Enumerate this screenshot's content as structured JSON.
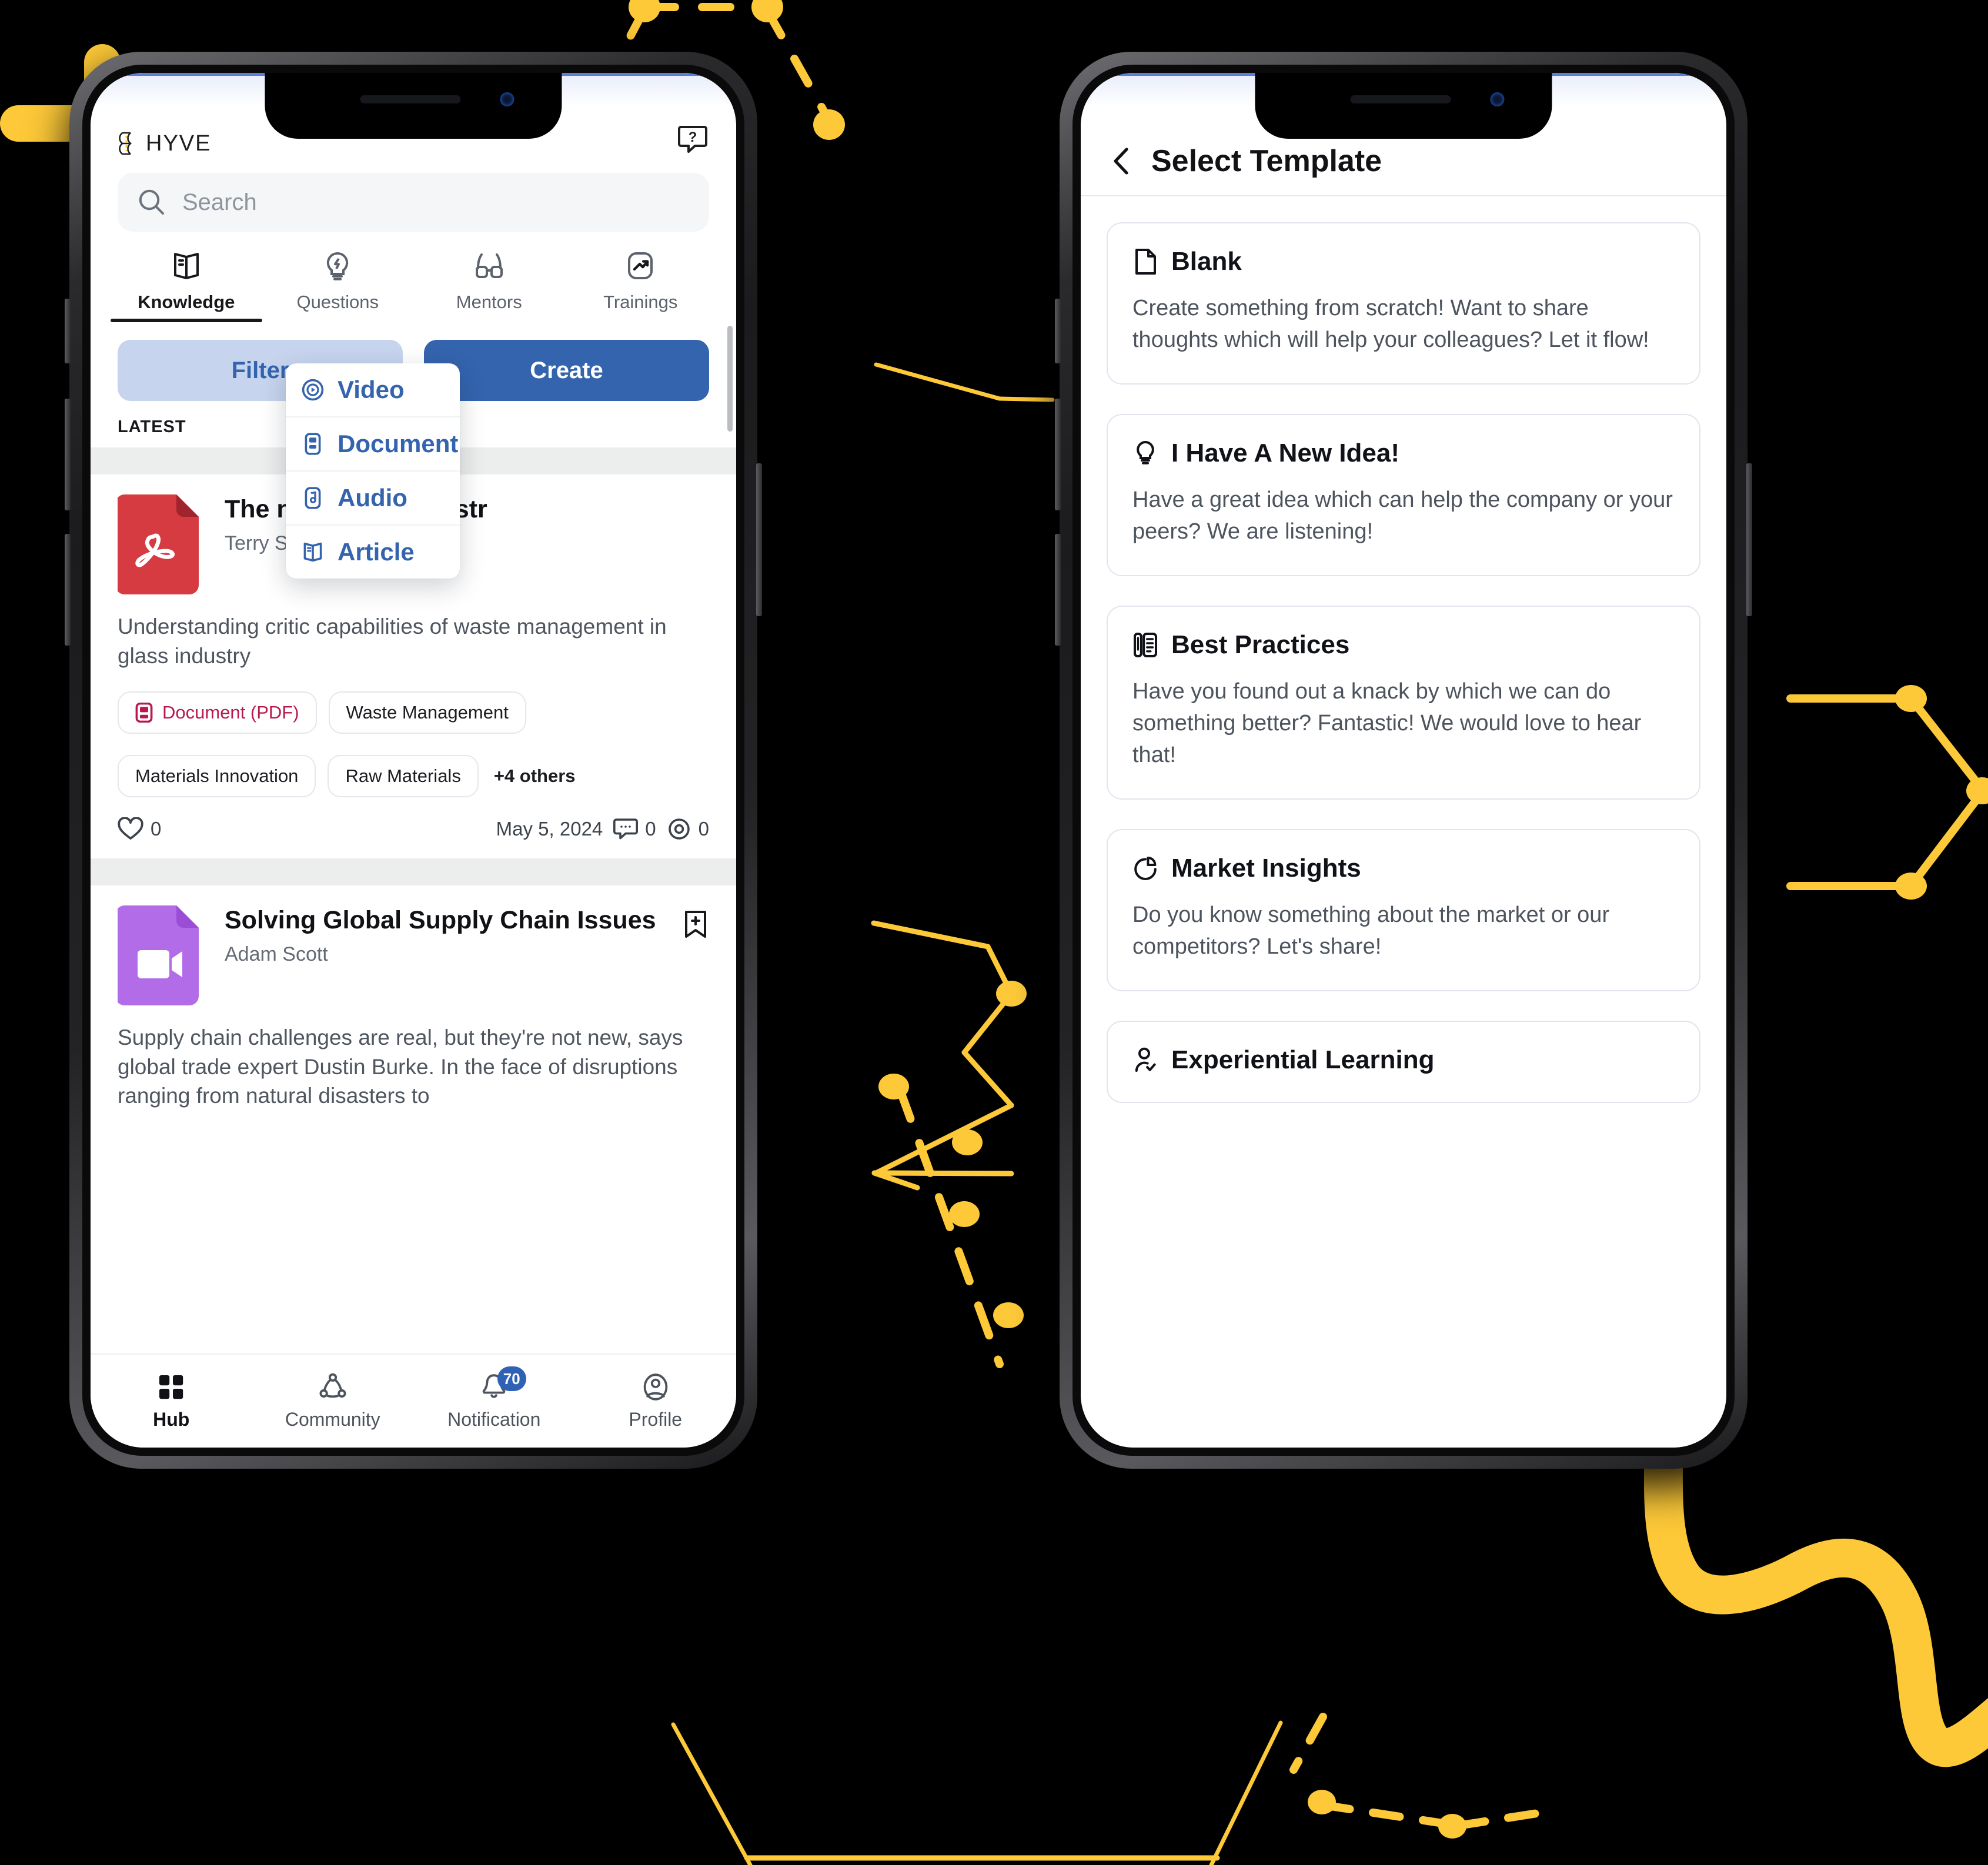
{
  "app": {
    "brand": "HYVE",
    "help_icon": "help-question-icon",
    "search": {
      "placeholder": "Search",
      "icon": "search-icon"
    },
    "tabs": [
      {
        "label": "Knowledge",
        "icon": "book-icon",
        "active": true
      },
      {
        "label": "Questions",
        "icon": "lightbulb-bolt-icon",
        "active": false
      },
      {
        "label": "Mentors",
        "icon": "glasses-icon",
        "active": false
      },
      {
        "label": "Trainings",
        "icon": "trending-up-icon",
        "active": false
      }
    ],
    "filter_label": "Filter",
    "create_label": "Create",
    "section_label": "LATEST",
    "create_menu": [
      {
        "label": "Video",
        "icon": "play-circle-icon"
      },
      {
        "label": "Document",
        "icon": "document-icon"
      },
      {
        "label": "Audio",
        "icon": "music-note-icon"
      },
      {
        "label": "Article",
        "icon": "open-book-icon"
      }
    ],
    "feed": [
      {
        "file_type": "pdf",
        "title": "The ne    manag   industr",
        "author": "Terry Sm",
        "description": "Understanding critic                  capabilities of waste management in glass industry",
        "tags": [
          "Document (PDF)",
          "Waste Management",
          "Materials Innovation",
          "Raw Materials"
        ],
        "tags_more": "+4 others",
        "likes": "0",
        "date": "May 5, 2024",
        "comments": "0",
        "views": "0"
      },
      {
        "file_type": "video",
        "title": "Solving Global Supply Chain Issues",
        "author": "Adam Scott",
        "description": "Supply chain challenges are real, but they're not new, says global trade expert Dustin Burke. In the face of disruptions ranging from natural disasters to"
      }
    ],
    "bottom_nav": [
      {
        "label": "Hub",
        "icon": "grid-icon",
        "active": true,
        "badge": ""
      },
      {
        "label": "Community",
        "icon": "community-icon",
        "active": false,
        "badge": ""
      },
      {
        "label": "Notification",
        "icon": "bell-icon",
        "active": false,
        "badge": "70"
      },
      {
        "label": "Profile",
        "icon": "user-circle-icon",
        "active": false,
        "badge": ""
      }
    ]
  },
  "template_screen": {
    "back_icon": "chevron-left-icon",
    "title": "Select Template",
    "cards": [
      {
        "icon": "blank-page-icon",
        "title": "Blank",
        "description": "Create something from scratch! Want to share thoughts which will help your colleagues? Let it flow!"
      },
      {
        "icon": "lightbulb-icon",
        "title": "I Have A New Idea!",
        "description": "Have a great idea which can help the company or your peers? We are listening!"
      },
      {
        "icon": "notebook-pen-icon",
        "title": "Best Practices",
        "description": "Have you found out a knack by which we can do something better? Fantastic! We would love to hear that!"
      },
      {
        "icon": "pie-chart-icon",
        "title": "Market Insights",
        "description": "Do you know something about the market or our competitors? Let's share!"
      },
      {
        "icon": "user-check-icon",
        "title": "Experiential Learning",
        "description": ""
      }
    ]
  },
  "colors": {
    "accent_blue": "#3464ae",
    "accent_blue_soft": "#c6d4ee",
    "yellow": "#FDC938",
    "pdf_red": "#d63b42",
    "video_purple": "#b36ce8",
    "badge_blue": "#2f62b4",
    "tag_red": "#b8194c",
    "background": "#000000"
  }
}
